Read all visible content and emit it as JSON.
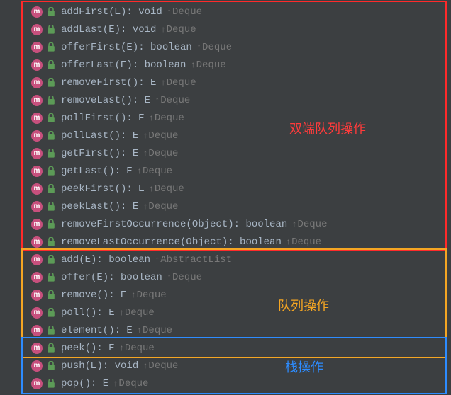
{
  "rows": [
    {
      "sig": "addFirst(E): void",
      "up": "Deque"
    },
    {
      "sig": "addLast(E): void",
      "up": "Deque"
    },
    {
      "sig": "offerFirst(E): boolean",
      "up": "Deque"
    },
    {
      "sig": "offerLast(E): boolean",
      "up": "Deque"
    },
    {
      "sig": "removeFirst(): E",
      "up": "Deque"
    },
    {
      "sig": "removeLast(): E",
      "up": "Deque"
    },
    {
      "sig": "pollFirst(): E",
      "up": "Deque"
    },
    {
      "sig": "pollLast(): E",
      "up": "Deque"
    },
    {
      "sig": "getFirst(): E",
      "up": "Deque"
    },
    {
      "sig": "getLast(): E",
      "up": "Deque"
    },
    {
      "sig": "peekFirst(): E",
      "up": "Deque"
    },
    {
      "sig": "peekLast(): E",
      "up": "Deque"
    },
    {
      "sig": "removeFirstOccurrence(Object): boolean",
      "up": "Deque"
    },
    {
      "sig": "removeLastOccurrence(Object): boolean",
      "up": "Deque"
    },
    {
      "sig": "add(E): boolean",
      "up": "AbstractList"
    },
    {
      "sig": "offer(E): boolean",
      "up": "Deque"
    },
    {
      "sig": "remove(): E",
      "up": "Deque"
    },
    {
      "sig": "poll(): E",
      "up": "Deque"
    },
    {
      "sig": "element(): E",
      "up": "Deque"
    },
    {
      "sig": "peek(): E",
      "up": "Deque"
    },
    {
      "sig": "push(E): void",
      "up": "Deque"
    },
    {
      "sig": "pop(): E",
      "up": "Deque"
    }
  ],
  "groups": {
    "red": {
      "label": "双端队列操作",
      "start": 0,
      "end": 13
    },
    "orange": {
      "label": "队列操作",
      "start": 14,
      "end": 19
    },
    "blue": {
      "label": "栈操作",
      "start": 19,
      "end": 21
    }
  },
  "icon_badge_letter": "m"
}
